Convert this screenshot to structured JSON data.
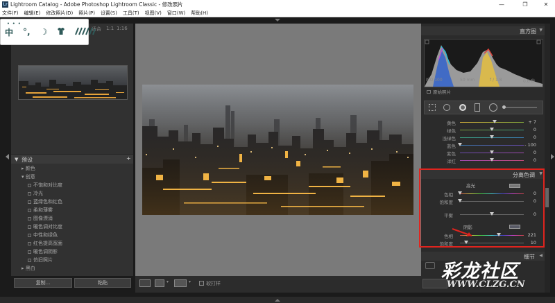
{
  "window": {
    "title": "Lightroom Catalog - Adobe Photoshop Lightroom Classic - 修改照片",
    "app_icon": "Lr",
    "controls": [
      "minimize-icon",
      "maximize-icon",
      "close-icon"
    ]
  },
  "menu": [
    "文件(F)",
    "编辑(E)",
    "修改照片(D)",
    "照片(P)",
    "设置(S)",
    "工具(T)",
    "视图(V)",
    "窗口(W)",
    "帮助(H)"
  ],
  "ime_toolbar": {
    "items": [
      "中",
      "°,",
      "☽",
      "👕",
      "⁄⁄⁄"
    ]
  },
  "navigator": {
    "label": "适合",
    "zoom1": "1:1",
    "zoom2": "1:16"
  },
  "presets": {
    "title": "预设",
    "items": [
      {
        "label": "颜色",
        "kind": "folder-collapsed"
      },
      {
        "label": "创意",
        "kind": "folder-expanded"
      },
      {
        "label": "不饱和对比度",
        "kind": "preset"
      },
      {
        "label": "冷光",
        "kind": "preset"
      },
      {
        "label": "蓝绿色和红色",
        "kind": "preset"
      },
      {
        "label": "柔和薄雾",
        "kind": "preset"
      },
      {
        "label": "图像漂消",
        "kind": "preset"
      },
      {
        "label": "暖色调对比度",
        "kind": "preset"
      },
      {
        "label": "中性和绿色",
        "kind": "preset"
      },
      {
        "label": "红色提高宽面",
        "kind": "preset"
      },
      {
        "label": "暖色调阴影",
        "kind": "preset"
      },
      {
        "label": "仿旧照片",
        "kind": "preset"
      },
      {
        "label": "黑白",
        "kind": "folder-collapsed"
      }
    ]
  },
  "left_buttons": {
    "copy": "复制...",
    "paste": "粘贴"
  },
  "toolbar": {
    "soft_proof": "软打样"
  },
  "histogram": {
    "title": "直方图",
    "iso": "ISO 100",
    "focal": "50 mm",
    "aperture": "f / 1.8",
    "shutter": "0.6 秒",
    "original_photo": "原始照片"
  },
  "hsl_sliders": [
    {
      "label": "黄色",
      "value": "+ 7",
      "knob": 0.57
    },
    {
      "label": "绿色",
      "value": "0",
      "knob": 0.5
    },
    {
      "label": "浅绿色",
      "value": "0",
      "knob": 0.5
    },
    {
      "label": "蓝色",
      "value": "- 100",
      "knob": 0.0
    },
    {
      "label": "紫色",
      "value": "0",
      "knob": 0.5
    },
    {
      "label": "洋红",
      "value": "0",
      "knob": 0.5
    }
  ],
  "split_toning": {
    "title": "分离色调",
    "highlights_label": "高光",
    "highlights": [
      {
        "label": "色相",
        "value": "0",
        "knob": 0.0
      },
      {
        "label": "饱和度",
        "value": "0",
        "knob": 0.0
      }
    ],
    "balance": {
      "label": "平衡",
      "value": "0",
      "knob": 0.5
    },
    "shadows_label": "阴影",
    "shadows": [
      {
        "label": "色相",
        "value": "221",
        "knob": 0.61
      },
      {
        "label": "饱和度",
        "value": "10",
        "knob": 0.1
      }
    ]
  },
  "detail_title": "细节",
  "watermark": {
    "line1": "彩龙社区",
    "line2": "WWW.CLZG.CN"
  }
}
